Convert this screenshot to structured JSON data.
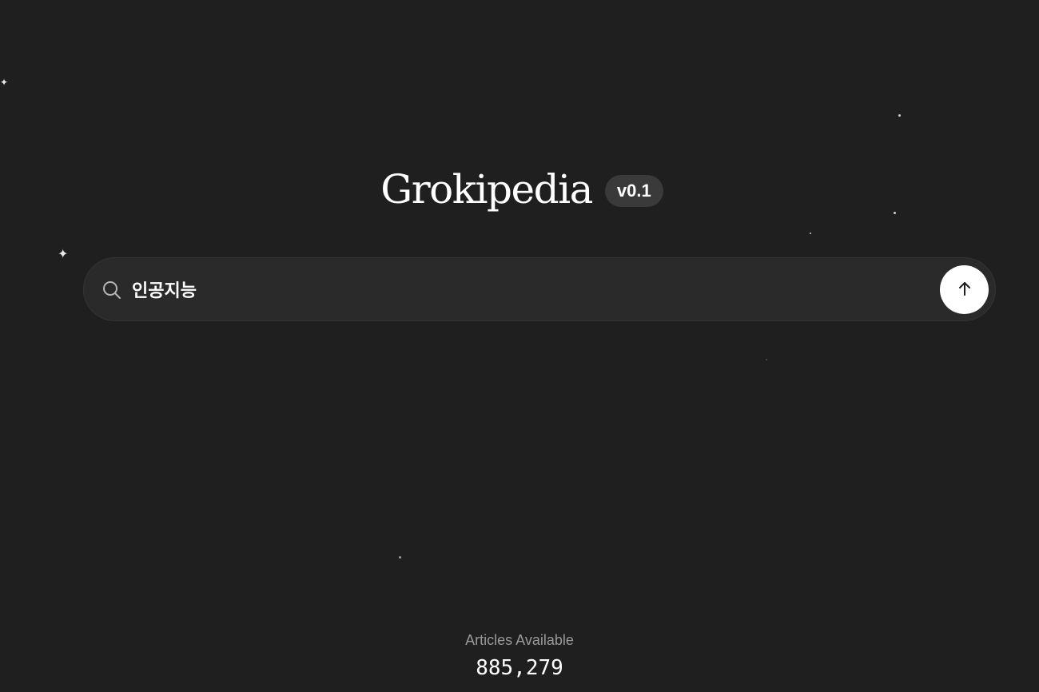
{
  "header": {
    "title": "Grokipedia",
    "version_badge": "v0.1"
  },
  "search": {
    "value": "인공지능",
    "icon": "search-icon",
    "submit_icon": "arrow-up-icon"
  },
  "stats": {
    "label": "Articles Available",
    "count": "885,279"
  },
  "colors": {
    "background": "#1f1f1f",
    "search_bar": "#2a2a2a",
    "badge": "#3a3a3a",
    "submit_button": "#ffffff",
    "muted_text": "#9a9a9a"
  }
}
